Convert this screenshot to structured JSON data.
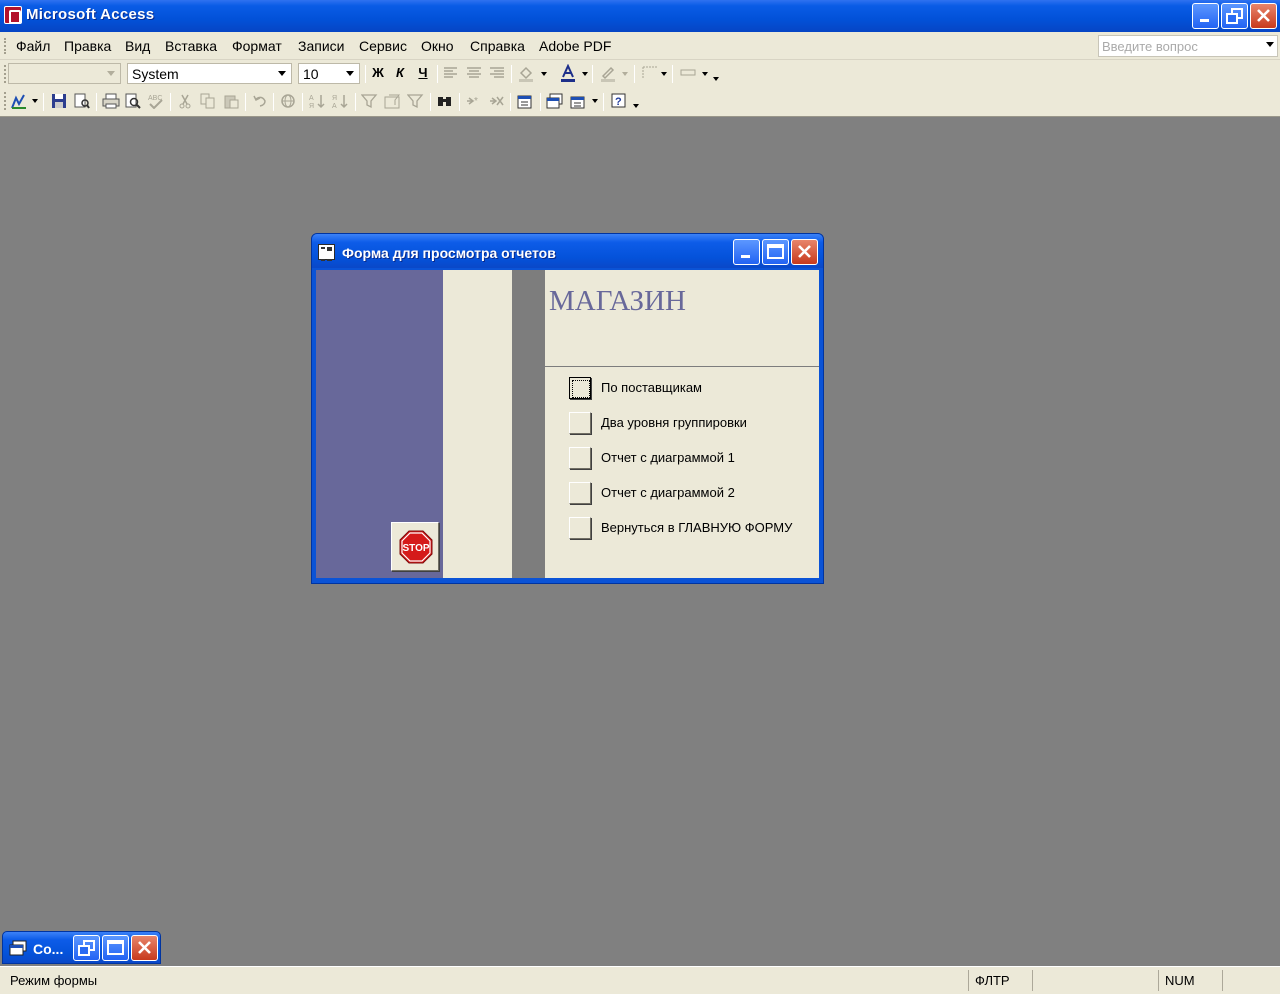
{
  "app": {
    "title": "Microsoft Access"
  },
  "menu": {
    "items": [
      {
        "label": "Файл"
      },
      {
        "label": "Правка"
      },
      {
        "label": "Вид"
      },
      {
        "label": "Вставка"
      },
      {
        "label": "Формат"
      },
      {
        "label": "Записи"
      },
      {
        "label": "Сервис"
      },
      {
        "label": "Окно"
      },
      {
        "label": "Справка"
      },
      {
        "label": "Adobe PDF"
      }
    ],
    "help_placeholder": "Введите вопрос"
  },
  "formatting_toolbar": {
    "object_combo": "",
    "font_name": "System",
    "font_size": "10",
    "bold_label": "Ж",
    "italic_label": "К",
    "underline_label": "Ч"
  },
  "form_window": {
    "title": "Форма для просмотра отчетов",
    "header": "МАГАЗИН",
    "buttons": [
      {
        "label": "По поставщикам"
      },
      {
        "label": "Два уровня группировки"
      },
      {
        "label": "Отчет с диаграммой 1"
      },
      {
        "label": "Отчет с диаграммой 2"
      },
      {
        "label": "Вернуться в ГЛАВНУЮ ФОРМУ"
      }
    ],
    "stop_label": "STOP",
    "colors": {
      "panel": "#68689a",
      "header_text": "#68689a",
      "bar": "#7d7d7d"
    }
  },
  "minimized_window": {
    "title": "Со..."
  },
  "status": {
    "mode": "Режим формы",
    "filter": "ФЛТР",
    "num": "NUM"
  },
  "icons": [
    "access-app-icon",
    "form-icon",
    "save-icon",
    "print-icon",
    "print-preview-icon",
    "spelling-icon",
    "cut-icon",
    "copy-icon",
    "paste-icon",
    "undo-icon",
    "sort-ascending-icon",
    "sort-descending-icon",
    "filter-icon",
    "find-icon",
    "help-icon",
    "stop-icon"
  ]
}
